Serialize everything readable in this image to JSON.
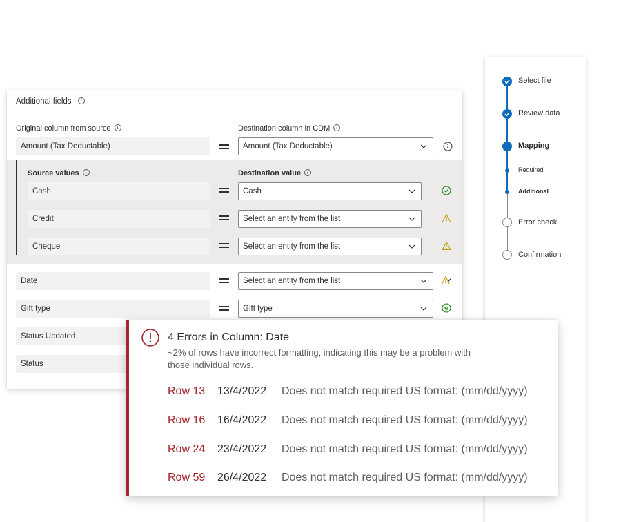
{
  "stepper": {
    "steps": [
      {
        "label": "Select file",
        "state": "done"
      },
      {
        "label": "Review data",
        "state": "done"
      },
      {
        "label": "Mapping",
        "state": "current"
      },
      {
        "label": "Required",
        "state": "substep"
      },
      {
        "label": "Additional",
        "state": "substep-current"
      },
      {
        "label": "Error check",
        "state": "todo"
      },
      {
        "label": "Confirmation",
        "state": "todo"
      }
    ]
  },
  "card": {
    "title": "Additional fields",
    "original_column_label": "Original column from source",
    "destination_column_label": "Destination column in CDM",
    "amount_source": "Amount (Tax Deductable)",
    "amount_destination": "Amount (Tax Deductable)",
    "source_values_label": "Source values",
    "destination_value_label": "Destination value",
    "value_rows": [
      {
        "source": "Cash",
        "destination": "Cash",
        "status": "success"
      },
      {
        "source": "Credit",
        "destination": "Select an entity from the list",
        "status": "warning"
      },
      {
        "source": "Cheque",
        "destination": "Select an entity from the list",
        "status": "warning"
      }
    ],
    "field_rows": [
      {
        "source": "Date",
        "destination": "Select an entity from the list",
        "status": "warning-edit"
      },
      {
        "source": "Gift type",
        "destination": "Gift type",
        "status": "success-expand"
      },
      {
        "source": "Status Updated"
      },
      {
        "source": "Status"
      }
    ]
  },
  "error_popup": {
    "title": "4 Errors in Column: Date",
    "description": "~2% of rows have incorrect formatting, indicating this may be a problem with those individual rows.",
    "rows": [
      {
        "row": "Row 13",
        "date": "13/4/2022",
        "message": "Does not match required US format: (mm/dd/yyyy)"
      },
      {
        "row": "Row 16",
        "date": "16/4/2022",
        "message": "Does not match required US format: (mm/dd/yyyy)"
      },
      {
        "row": "Row 24",
        "date": "23/4/2022",
        "message": "Does not match required US format: (mm/dd/yyyy)"
      },
      {
        "row": "Row 59",
        "date": "26/4/2022",
        "message": "Does not match required US format: (mm/dd/yyyy)"
      }
    ]
  },
  "colors": {
    "accent": "#0f6cbd",
    "error": "#a4262c",
    "success": "#107c10",
    "warning": "#c19c00"
  }
}
